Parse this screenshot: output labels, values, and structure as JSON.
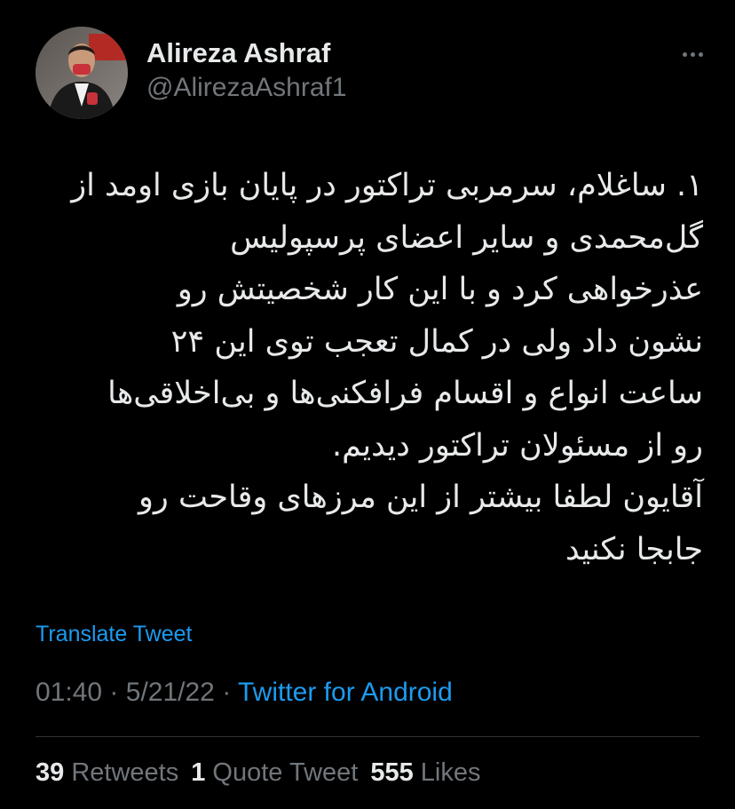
{
  "author": {
    "display_name": "Alireza Ashraf",
    "handle": "@AlirezaAshraf1"
  },
  "tweet": {
    "lines": [
      "۱. ساغلام، سرمربی تراکتور در پایان بازی اومد از",
      "گل‌محمدی و سایر اعضای پرسپولیس",
      "عذرخواهی کرد و با این کار شخصیتش رو",
      "نشون داد ولی در کمال تعجب توی این ۲۴",
      "ساعت انواع و اقسام فرافکنی‌ها و بی‌اخلاقی‌ها",
      "رو از مسئولان تراکتور دیدیم.",
      "آقایون لطفا بیشتر از این مرزهای وقاحت رو",
      "جابجا نکنید"
    ]
  },
  "translate_label": "Translate Tweet",
  "meta": {
    "time": "01:40",
    "separator": "·",
    "date": "5/21/22",
    "source": "Twitter for Android"
  },
  "stats": {
    "retweets_count": "39",
    "retweets_label": "Retweets",
    "quotes_count": "1",
    "quotes_label": "Quote Tweet",
    "likes_count": "555",
    "likes_label": "Likes"
  },
  "icons": {
    "more": "more-horizontal-icon"
  },
  "colors": {
    "background": "#000000",
    "text": "#e7e9ea",
    "secondary": "#71767b",
    "link": "#1d9bf0",
    "divider": "#2f3336"
  }
}
